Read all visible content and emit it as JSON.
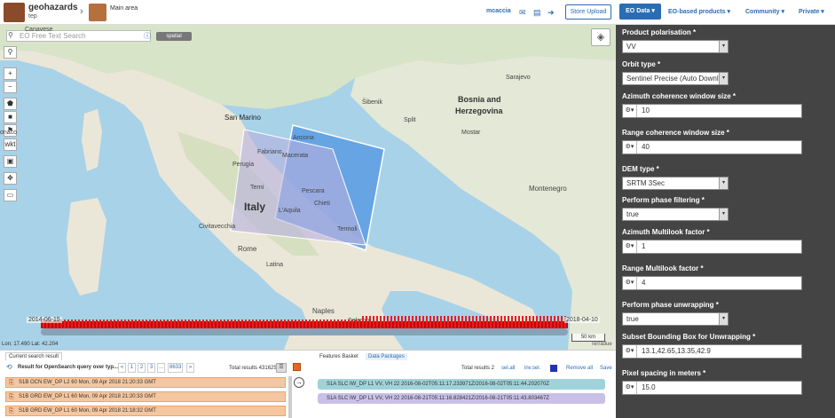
{
  "header": {
    "brand": "geohazards",
    "brand_sub": "tep",
    "crumb": "Main area",
    "user": "mcaccia",
    "store_upload": "Store Upload",
    "menus": [
      "EO Data ▾",
      "EO-based products ▾",
      "Community ▾",
      "Private ▾"
    ]
  },
  "map": {
    "search_placeholder": "EO Free Text Search",
    "spatial": "spatial",
    "labels": {
      "canavese": "Canavese",
      "san_marino": "San Marino",
      "italy": "Italy",
      "bosnia": "Bosnia and",
      "herzegovina": "Herzegovina",
      "montenegro": "Montenegro",
      "rome": "Rome",
      "naples": "Naples",
      "ancona": "Ancona",
      "perugia": "Perugia",
      "pescara": "Pescara",
      "laquila": "L'Aquila",
      "terni": "Terni",
      "fabriano": "Fabriano",
      "macerata": "Macerata",
      "termoli": "Termoli",
      "chieti": "Chieti",
      "civitavecchia": "Civitavecchia",
      "latina": "Latina",
      "salerno": "Salerno",
      "split": "Split",
      "mostar": "Mostar",
      "sarajevo": "Sarajevo",
      "sibenik": "Šibenik",
      "monaco": "onaco"
    },
    "timeline_start": "2014-06-15",
    "timeline_end": "2018-04-10",
    "coords": "Lon: 17.490 Lat: 42.204",
    "scale": "50 km",
    "attribution": "Terradue"
  },
  "results": {
    "tab": "Current search result",
    "title": "Result for OpenSearch query over typ...",
    "pages": [
      "«",
      "1",
      "2",
      "3",
      "...",
      "8633",
      "»"
    ],
    "total": "Total results 431625",
    "rows": [
      "S1B OCN EW_DP L2 60 Mon, 09 Apr 2018 21:20:33 GMT",
      "S1B GRD EW_DP L1 60 Mon, 09 Apr 2018 21:20:33 GMT",
      "S1B GRD EW_DP L1 60 Mon, 09 Apr 2018 21:18:32 GMT"
    ]
  },
  "basket": {
    "tabs": [
      "Features Basket",
      "Data Packages"
    ],
    "total": "Total results 2",
    "actions": [
      "sel.all",
      "inv.sel.",
      "Remove all",
      "Save"
    ],
    "rows": [
      {
        "text": "S1A SLC IW_DP L1 VV, VH 22 2016-08-02T05:11:17.233971Z/2016-08-02T05:11:44.202070Z",
        "color": "#9fd3d9"
      },
      {
        "text": "S1A SLC IW_DP L1 VV, VH 22 2016-08-21T05:11:16.828421Z/2016-08-21T05:11:43.803467Z",
        "color": "#c9c0e8"
      }
    ]
  },
  "form": {
    "fields": [
      {
        "label": "Product polarisation *",
        "value": "VV",
        "kind": "select"
      },
      {
        "label": "Orbit type *",
        "value": "Sentinel Precise (Auto Downl",
        "kind": "select"
      },
      {
        "label": "Azimuth coherence window size *",
        "value": "10",
        "kind": "input"
      },
      {
        "label": "Range coherence window size *",
        "value": "40",
        "kind": "input"
      },
      {
        "label": "DEM type *",
        "value": "SRTM 3Sec",
        "kind": "select"
      },
      {
        "label": "Perform phase filtering *",
        "value": "true",
        "kind": "select"
      },
      {
        "label": "Azimuth Multilook factor *",
        "value": "1",
        "kind": "input"
      },
      {
        "label": "Range Multilook factor *",
        "value": "4",
        "kind": "input"
      },
      {
        "label": "Perform phase unwrapping *",
        "value": "true",
        "kind": "select"
      },
      {
        "label": "Subset Bounding Box for Unwrapping *",
        "value": "13.1,42.65,13.35,42.9",
        "kind": "input"
      },
      {
        "label": "Pixel spacing in meters *",
        "value": "15.0",
        "kind": "input"
      }
    ]
  }
}
